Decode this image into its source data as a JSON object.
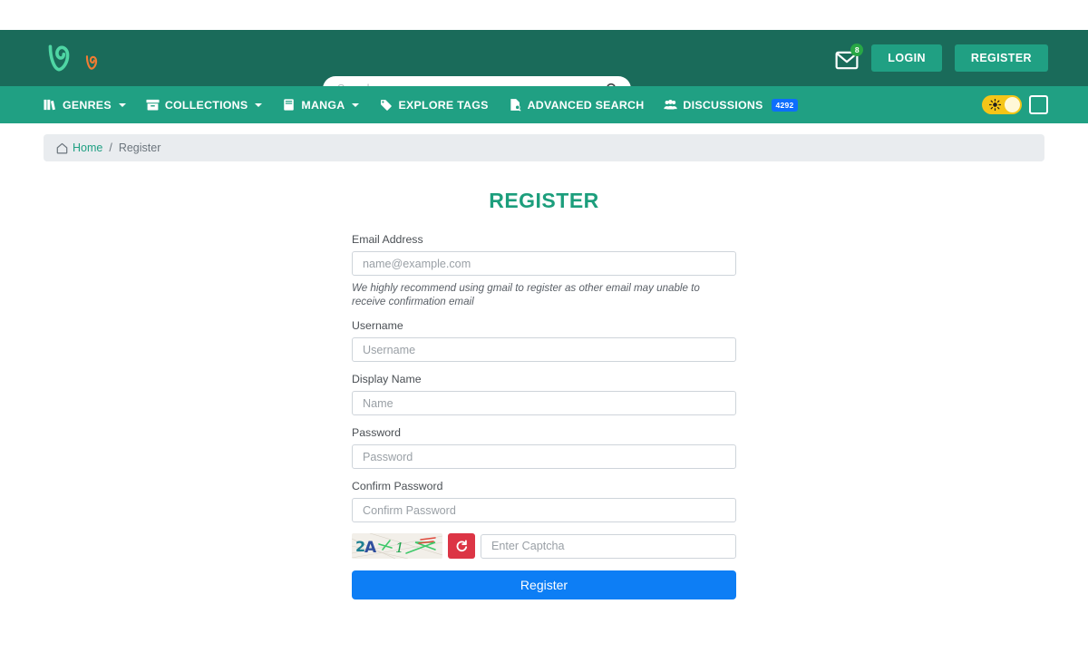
{
  "colors": {
    "header_bg": "#1a6b5a",
    "nav_bg": "#20a083",
    "accent_green": "#1c9e7c",
    "submit_blue": "#0d7ef5",
    "badge_blue": "#0d6efd",
    "badge_green": "#28a745",
    "refresh_red": "#dc3545",
    "toggle_yellow": "#f5c518"
  },
  "header": {
    "logo_name": "vine-logo",
    "logo_secondary_name": "vine-logo-small",
    "search": {
      "placeholder": "Search manga...",
      "value": "",
      "icon": "search-icon"
    },
    "messages": {
      "icon": "envelope-icon",
      "badge": "8"
    },
    "login_label": "LOGIN",
    "register_label": "REGISTER"
  },
  "nav": {
    "items": [
      {
        "label": "GENRES",
        "icon": "books-icon",
        "has_caret": true
      },
      {
        "label": "COLLECTIONS",
        "icon": "archive-box-icon",
        "has_caret": true
      },
      {
        "label": "MANGA",
        "icon": "book-icon",
        "has_caret": true
      },
      {
        "label": "EXPLORE TAGS",
        "icon": "tag-icon",
        "has_caret": false
      },
      {
        "label": "ADVANCED SEARCH",
        "icon": "file-search-icon",
        "has_caret": false
      },
      {
        "label": "DISCUSSIONS",
        "icon": "users-icon",
        "has_caret": false,
        "badge": "4292"
      }
    ],
    "theme_toggle": {
      "icon": "sun-icon",
      "state": "light"
    },
    "panel_button": {
      "icon": "square-outline-icon"
    }
  },
  "breadcrumb": {
    "home_icon": "home-icon",
    "home_label": "Home",
    "separator": "/",
    "current": "Register"
  },
  "main": {
    "title": "REGISTER",
    "fields": [
      {
        "label": "Email Address",
        "placeholder": "name@example.com",
        "value": "",
        "name": "email-field"
      },
      {
        "label": "Username",
        "placeholder": "Username",
        "value": "",
        "name": "username-field"
      },
      {
        "label": "Display Name",
        "placeholder": "Name",
        "value": "",
        "name": "display-name-field"
      },
      {
        "label": "Password",
        "placeholder": "Password",
        "value": "",
        "name": "password-field"
      },
      {
        "label": "Confirm Password",
        "placeholder": "Confirm Password",
        "value": "",
        "name": "confirm-password-field"
      }
    ],
    "email_help": "We highly recommend using gmail to register as other email may unable to receive confirmation email",
    "captcha": {
      "image_text": "2A 1",
      "refresh_icon": "refresh-icon",
      "placeholder": "Enter Captcha",
      "value": ""
    },
    "submit_label": "Register"
  }
}
